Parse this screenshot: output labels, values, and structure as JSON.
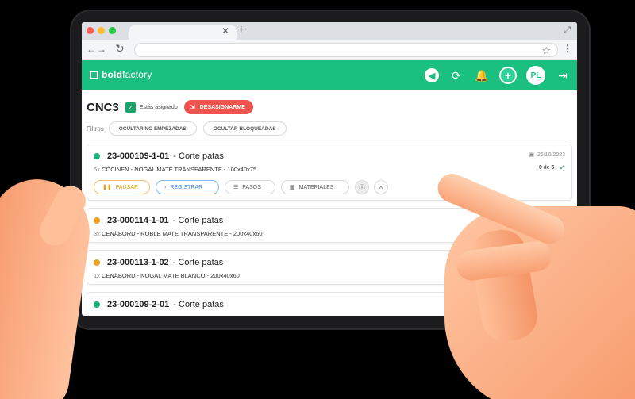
{
  "app": {
    "logo_bold": "bold",
    "logo_light": "factory"
  },
  "header": {
    "avatar_initials": "PL"
  },
  "workcenter": {
    "title": "CNC3",
    "assigned_text": "Estás asignado",
    "unassign_label": "DESASIGNARME"
  },
  "filters": {
    "label": "Filtros",
    "chips": [
      "OCULTAR NO EMPEZADAS",
      "OCULTAR BLOQUEADAS"
    ]
  },
  "orders": [
    {
      "code": "23-000109-1-01",
      "operation": "- Corte patas",
      "qty": "5x",
      "description": "CÓCINEN - NOGAL MATE TRANSPARENTE - 100x40x75",
      "date": "26/10/2023",
      "progress_done": "0",
      "progress_of": "de",
      "progress_total": "5",
      "status_color": "#19b278",
      "actions": {
        "pause": "PAUSAR",
        "register": "REGISTRAR",
        "steps": "PASOS",
        "materials": "MATERIALES"
      }
    },
    {
      "code": "23-000114-1-01",
      "operation": "- Corte patas",
      "qty": "3x",
      "description": "CENÄBORD - ROBLE MATE TRANSPARENTE - 200x40x60",
      "date": "023",
      "status_color": "#f2a21b"
    },
    {
      "code": "23-000113-1-02",
      "operation": "- Corte patas",
      "qty": "1x",
      "description": "CENÄBORD - NOGAL MATE BLANCO - 200x40x60",
      "status_color": "#f2a21b"
    },
    {
      "code": "23-000109-2-01",
      "operation": "- Corte patas",
      "status_color": "#19b278"
    }
  ]
}
